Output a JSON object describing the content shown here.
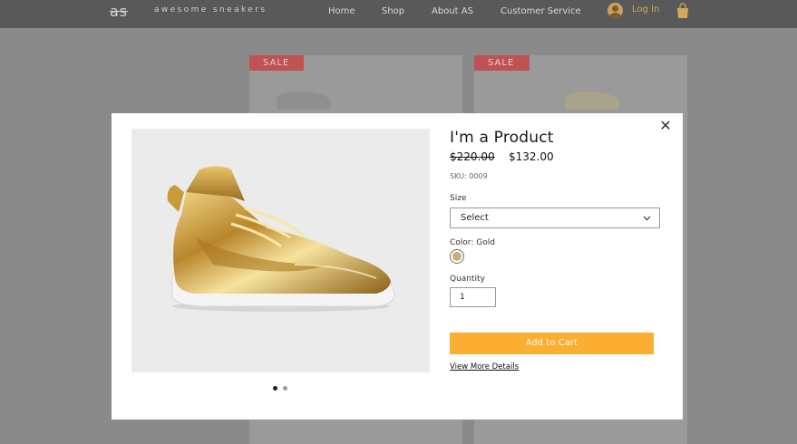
{
  "header": {
    "logo": "as",
    "brand": "awesome sneakers",
    "nav": [
      "Home",
      "Shop",
      "About AS",
      "Customer Service"
    ],
    "login_label": "Log In",
    "icons": {
      "login": "user-avatar-icon",
      "cart": "shopping-bag-icon"
    },
    "colors": {
      "background": "#595959",
      "accent": "#d0a95c"
    }
  },
  "background_cards": [
    {
      "badge": "SALE"
    },
    {
      "badge": "SALE"
    }
  ],
  "modal": {
    "close_icon": "close-icon",
    "title": "I'm a Product",
    "price_original": "$220.00",
    "price_sale": "$132.00",
    "sku": "SKU: 0009",
    "size": {
      "label": "Size",
      "value": "Select"
    },
    "color": {
      "label": "Color: Gold",
      "swatch": "#c9b070"
    },
    "quantity": {
      "label": "Quantity",
      "value": "1"
    },
    "add_to_cart": "Add to Cart",
    "view_details": "View More Details",
    "gallery": {
      "image": "gold-high-top-sneaker",
      "slides": 2,
      "active_slide": 1
    },
    "colors": {
      "button": "#fbae31",
      "sale_badge": "#cc3b3b"
    }
  }
}
